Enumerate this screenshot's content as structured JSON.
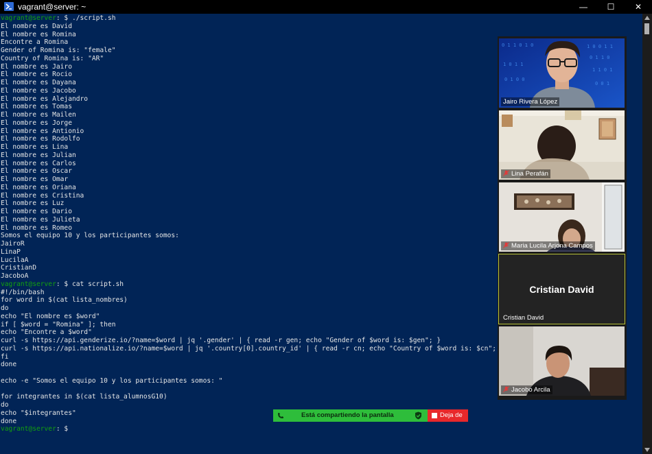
{
  "window": {
    "title": "vagrant@server: ~",
    "minimize": "—",
    "maximize": "☐",
    "close": "✕"
  },
  "terminal": {
    "lines": [
      {
        "user": "vagrant@server",
        "rest": ": $ ./script.sh"
      },
      {
        "text": "El nombre es David"
      },
      {
        "text": "El nombre es Romina"
      },
      {
        "text": "Encontre a Romina"
      },
      {
        "text": "Gender of Romina is: \"female\""
      },
      {
        "text": "Country of Romina is: \"AR\""
      },
      {
        "text": "El nombre es Jairo"
      },
      {
        "text": "El nombre es Rocio"
      },
      {
        "text": "El nombre es Dayana"
      },
      {
        "text": "El nombre es Jacobo"
      },
      {
        "text": "El nombre es Alejandro"
      },
      {
        "text": "El nombre es Tomas"
      },
      {
        "text": "El nombre es Mailen"
      },
      {
        "text": "El nombre es Jorge"
      },
      {
        "text": "El nombre es Antionio"
      },
      {
        "text": "El nombre es Rodolfo"
      },
      {
        "text": "El nombre es Lina"
      },
      {
        "text": "El nombre es Julian"
      },
      {
        "text": "El nombre es Carlos"
      },
      {
        "text": "El nombre es Oscar"
      },
      {
        "text": "El nombre es Omar"
      },
      {
        "text": "El nombre es Oriana"
      },
      {
        "text": "El nombre es Cristina"
      },
      {
        "text": "El nombre es Luz"
      },
      {
        "text": "El nombre es Dario"
      },
      {
        "text": "El nombre es Julieta"
      },
      {
        "text": "El nombre es Romeo"
      },
      {
        "text": "Somos el equipo 10 y los participantes somos:"
      },
      {
        "text": "JairoR"
      },
      {
        "text": "LinaP"
      },
      {
        "text": "LucilaA"
      },
      {
        "text": "CristianD"
      },
      {
        "text": "JacoboA"
      },
      {
        "user": "vagrant@server",
        "rest": ": $ cat script.sh"
      },
      {
        "text": "#!/bin/bash"
      },
      {
        "text": "for word in $(cat lista_nombres)"
      },
      {
        "text": "do"
      },
      {
        "text": "echo \"El nombre es $word\""
      },
      {
        "text": "if [ $word = \"Romina\" ]; then"
      },
      {
        "text": "echo \"Encontre a $word\""
      },
      {
        "text": "curl -s https://api.genderize.io/?name=$word | jq '.gender' | { read -r gen; echo \"Gender of $word is: $gen\"; }"
      },
      {
        "text": "curl -s https://api.nationalize.io/?name=$word | jq '.country[0].country_id' | { read -r cn; echo \"Country of $word is: $cn\"; }"
      },
      {
        "text": "fi"
      },
      {
        "text": "done"
      },
      {
        "text": ""
      },
      {
        "text": "echo -e \"Somos el equipo 10 y los participantes somos: \""
      },
      {
        "text": ""
      },
      {
        "text": "for integrantes in $(cat lista_alumnosG10)"
      },
      {
        "text": "do"
      },
      {
        "text": "echo \"$integrantes\""
      },
      {
        "text": "done"
      },
      {
        "user": "vagrant@server",
        "rest": ": $"
      }
    ]
  },
  "participants": [
    {
      "name": "Jairo Rivera López",
      "muted": false,
      "video": "jairo"
    },
    {
      "name": "Lina Perafán",
      "muted": true,
      "video": "lina"
    },
    {
      "name": "Maria Lucila Arjona Campos",
      "muted": true,
      "video": "maria"
    },
    {
      "name": "Cristian David",
      "muted": false,
      "video": "none",
      "display": "Cristian David",
      "active": true
    },
    {
      "name": "Jacobo Arcila",
      "muted": true,
      "video": "jacobo"
    }
  ],
  "share_bar": {
    "status": "Está compartiendo la pantalla",
    "stop_label": "Deja de"
  },
  "colors": {
    "terminal_bg": "#012456",
    "prompt_user": "#13a10e",
    "share_green": "#2ebd3b",
    "stop_red": "#e8282b"
  },
  "icons": [
    "powershell-icon",
    "minimize-icon",
    "maximize-icon",
    "close-icon",
    "muted-mic-icon",
    "phone-icon",
    "shield-icon",
    "stop-square-icon"
  ]
}
